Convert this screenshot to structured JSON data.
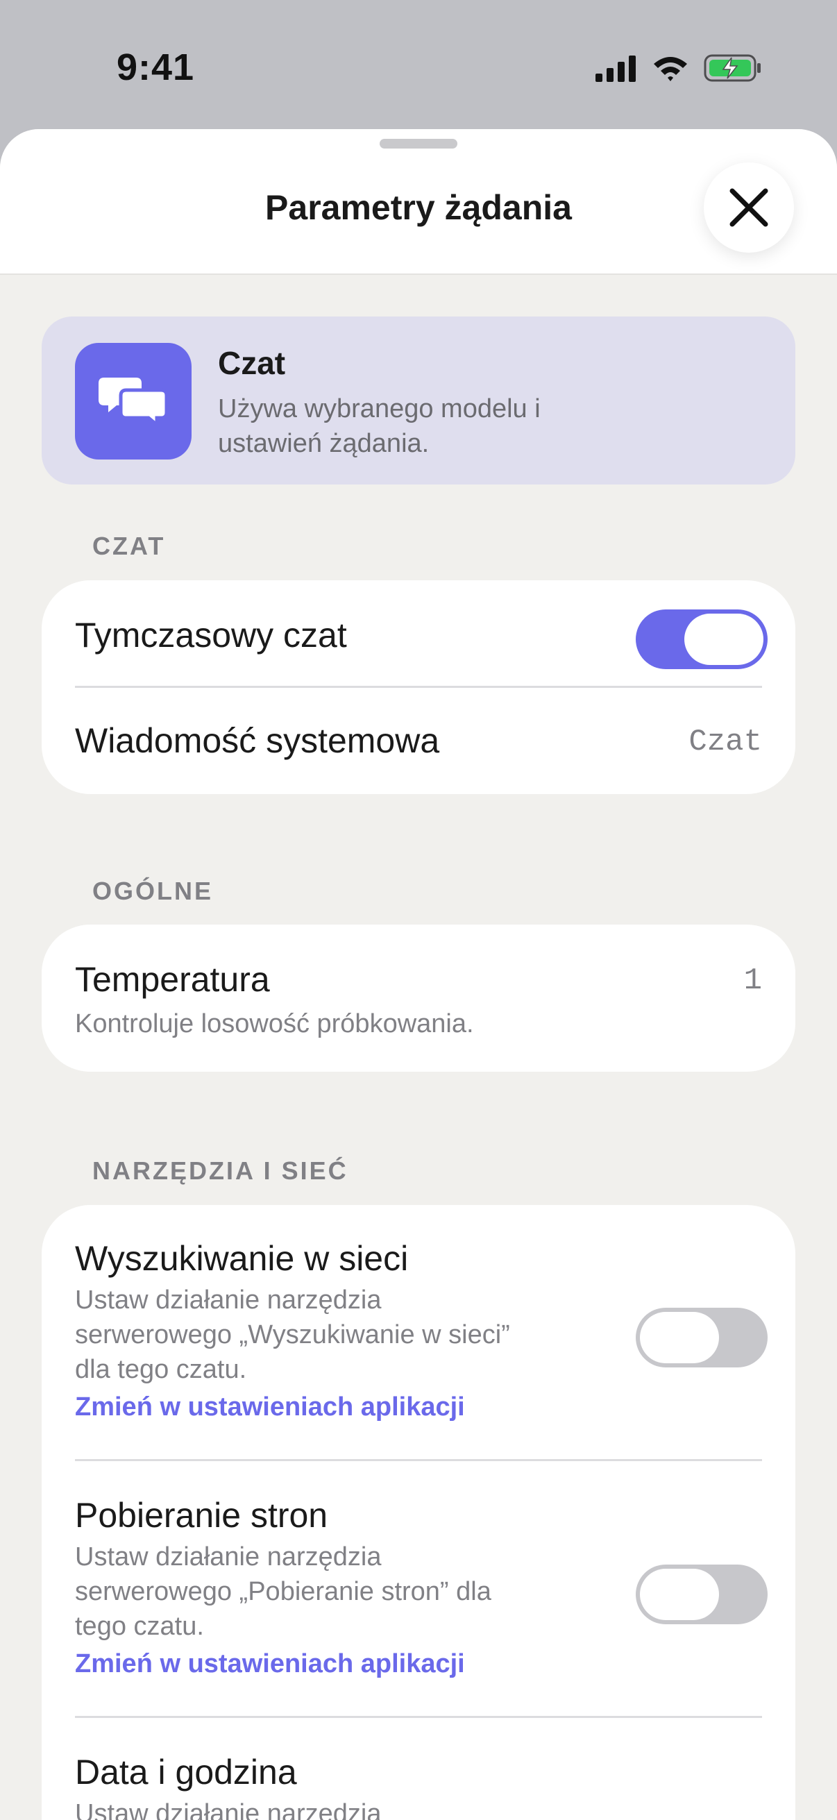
{
  "status_bar": {
    "time": "9:41",
    "icons": [
      "cellular-signal-icon",
      "wifi-icon",
      "battery-charging-icon"
    ]
  },
  "header": {
    "title": "Parametry żądania",
    "close_icon": "close-icon"
  },
  "mode_card": {
    "icon": "chat-bubbles-icon",
    "title": "Czat",
    "description": "Używa wybranego modelu i ustawień żądania."
  },
  "sections": {
    "chat": {
      "label": "CZAT",
      "temporary_chat": {
        "label": "Tymczasowy czat",
        "enabled": true
      },
      "system_message": {
        "label": "Wiadomość systemowa",
        "value": "Czat"
      }
    },
    "general": {
      "label": "OGÓLNE",
      "temperature": {
        "label": "Temperatura",
        "description": "Kontroluje losowość próbkowania.",
        "value": "1"
      }
    },
    "tools": {
      "label": "NARZĘDZIA I SIEĆ",
      "items": [
        {
          "label": "Wyszukiwanie w sieci",
          "description_lines": [
            "Ustaw działanie narzędzia",
            "serwerowego „Wyszukiwanie w sieci”",
            "dla tego czatu."
          ],
          "link": "Zmień w ustawieniach aplikacji",
          "enabled": false
        },
        {
          "label": "Pobieranie stron",
          "description_lines": [
            "Ustaw działanie narzędzia",
            "serwerowego „Pobieranie stron” dla",
            "tego czatu."
          ],
          "link": "Zmień w ustawieniach aplikacji",
          "enabled": false
        },
        {
          "label": "Data i godzina",
          "description_lines": [
            "Ustaw działanie narzędzia"
          ],
          "enabled": false
        }
      ]
    }
  },
  "colors": {
    "accent": "#6a69ea",
    "sheet_background": "#f1f0ed",
    "mode_card_background": "#dfdeee",
    "toggle_off": "#c7c7cb"
  }
}
